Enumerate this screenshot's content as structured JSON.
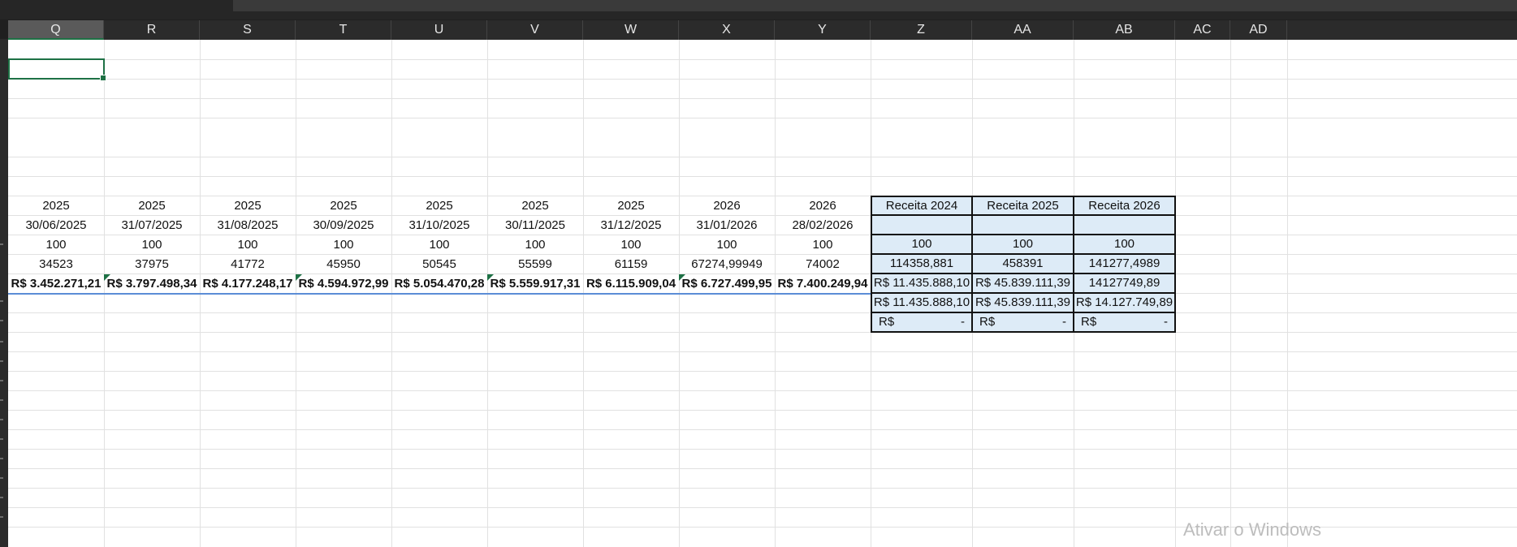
{
  "columns": [
    "Q",
    "R",
    "S",
    "T",
    "U",
    "V",
    "W",
    "X",
    "Y",
    "Z",
    "AA",
    "AB",
    "AC",
    "AD"
  ],
  "selected_column": "Q",
  "rows": {
    "year": [
      "2025",
      "2025",
      "2025",
      "2025",
      "2025",
      "2025",
      "2025",
      "2026",
      "2026"
    ],
    "date": [
      "30/06/2025",
      "31/07/2025",
      "31/08/2025",
      "30/09/2025",
      "31/10/2025",
      "30/11/2025",
      "31/12/2025",
      "31/01/2026",
      "28/02/2026"
    ],
    "hundred": [
      "100",
      "100",
      "100",
      "100",
      "100",
      "100",
      "100",
      "100",
      "100"
    ],
    "qty": [
      "34523",
      "37975",
      "41772",
      "45950",
      "50545",
      "55599",
      "61159",
      "67274,99949",
      "74002"
    ],
    "revenue": [
      "R$ 3.452.271,21",
      "R$ 3.797.498,34",
      "R$ 4.177.248,17",
      "R$ 4.594.972,99",
      "R$ 5.054.470,28",
      "R$ 5.559.917,31",
      "R$ 6.115.909,04",
      "R$ 6.727.499,95",
      "R$ 7.400.249,94"
    ]
  },
  "summary": {
    "headers": [
      "Receita 2024",
      "Receita 2025",
      "Receita 2026"
    ],
    "hundred": [
      "100",
      "100",
      "100"
    ],
    "qty": [
      "114358,881",
      "458391",
      "141277,4989"
    ],
    "revenue_raw": [
      "R$ 11.435.888,10",
      "R$ 45.839.111,39",
      "14127749,89"
    ],
    "revenue": [
      "R$ 11.435.888,10",
      "R$ 45.839.111,39",
      "R$ 14.127.749,89"
    ],
    "dash_prefix": [
      "R$",
      "R$",
      "R$"
    ],
    "dash_value": [
      "-",
      "-",
      "-"
    ]
  },
  "watermark": "Ativar o Windows",
  "colors": {
    "selection": "#1e7145",
    "summary_fill": "#ddebf7",
    "underline": "#5b8dd6"
  }
}
